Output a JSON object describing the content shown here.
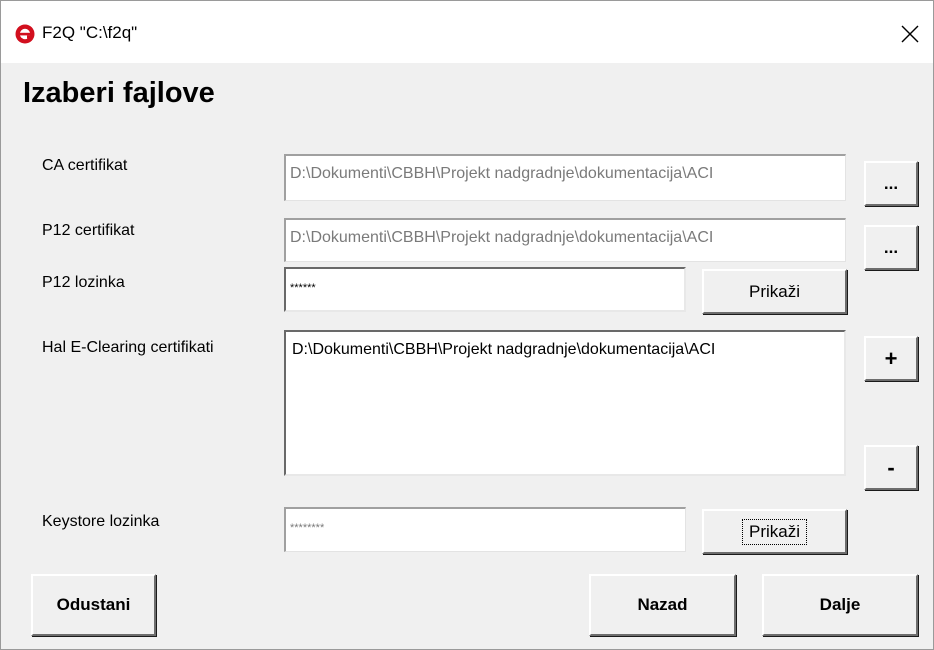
{
  "window": {
    "title": "F2Q \"C:\\f2q\"",
    "icon": "edge-e-icon",
    "close_glyph": "✕"
  },
  "heading": "Izaberi fajlove",
  "fields": {
    "ca_label": "CA certifikat",
    "ca_value": "D:\\Dokumenti\\CBBH\\Projekt nadgradnje\\dokumentacija\\ACI",
    "ca_browse": "...",
    "p12_label": "P12 certifikat",
    "p12_value": "D:\\Dokumenti\\CBBH\\Projekt nadgradnje\\dokumentacija\\ACI",
    "p12_browse": "...",
    "p12_password_label": "P12 lozinka",
    "p12_password_value": "******",
    "p12_show": "Prikaži",
    "hal_label": "Hal E-Clearing certifikati",
    "hal_list": [
      "D:\\Dokumenti\\CBBH\\Projekt nadgradnje\\dokumentacija\\ACI"
    ],
    "hal_add": "+",
    "hal_remove": "-",
    "keystore_label": "Keystore lozinka",
    "keystore_value": "********",
    "keystore_show": "Prikaži"
  },
  "footer": {
    "cancel": "Odustani",
    "back": "Nazad",
    "next": "Dalje"
  },
  "colors": {
    "icon_red": "#d20f1e",
    "background": "#f0f0f0"
  }
}
